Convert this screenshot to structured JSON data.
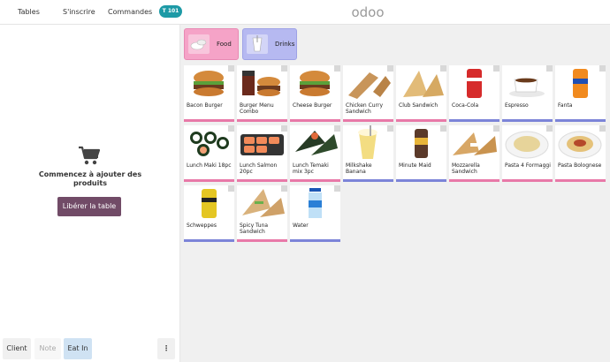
{
  "header": {
    "nav": [
      {
        "label": "Tables"
      },
      {
        "label": "S'inscrire"
      },
      {
        "label": "Commandes"
      }
    ],
    "table_badge": "T 101",
    "logo_text": "odoo"
  },
  "order_panel": {
    "empty_message": "Commencez à ajouter des produits",
    "free_table_button": "Libérer la table",
    "footer": {
      "client": "Client",
      "note": "Note",
      "eat_in": "Eat In",
      "more": "⋮"
    }
  },
  "categories": [
    {
      "label": "Food",
      "color": "#f5a3c7"
    },
    {
      "label": "Drinks",
      "color": "#b6b9f1"
    }
  ],
  "colors": {
    "food_stripe": "#e879a8",
    "drink_stripe": "#7c84d8",
    "accent": "#714b67",
    "badge": "#1d9aa6"
  },
  "products": [
    {
      "name": "Bacon Burger",
      "category": "food"
    },
    {
      "name": "Burger Menu Combo",
      "category": "food"
    },
    {
      "name": "Cheese Burger",
      "category": "food"
    },
    {
      "name": "Chicken Curry Sandwich",
      "category": "food"
    },
    {
      "name": "Club Sandwich",
      "category": "food"
    },
    {
      "name": "Coca-Cola",
      "category": "drinks"
    },
    {
      "name": "Espresso",
      "category": "drinks"
    },
    {
      "name": "Fanta",
      "category": "drinks"
    },
    {
      "name": "Lunch Maki 18pc",
      "category": "food"
    },
    {
      "name": "Lunch Salmon 20pc",
      "category": "food"
    },
    {
      "name": "Lunch Temaki mix 3pc",
      "category": "food"
    },
    {
      "name": "Milkshake Banana",
      "category": "drinks"
    },
    {
      "name": "Minute Maid",
      "category": "drinks"
    },
    {
      "name": "Mozzarella Sandwich",
      "category": "food"
    },
    {
      "name": "Pasta 4 Formaggi",
      "category": "food"
    },
    {
      "name": "Pasta Bolognese",
      "category": "food"
    },
    {
      "name": "Schweppes",
      "category": "drinks"
    },
    {
      "name": "Spicy Tuna Sandwich",
      "category": "food"
    },
    {
      "name": "Water",
      "category": "drinks"
    }
  ]
}
